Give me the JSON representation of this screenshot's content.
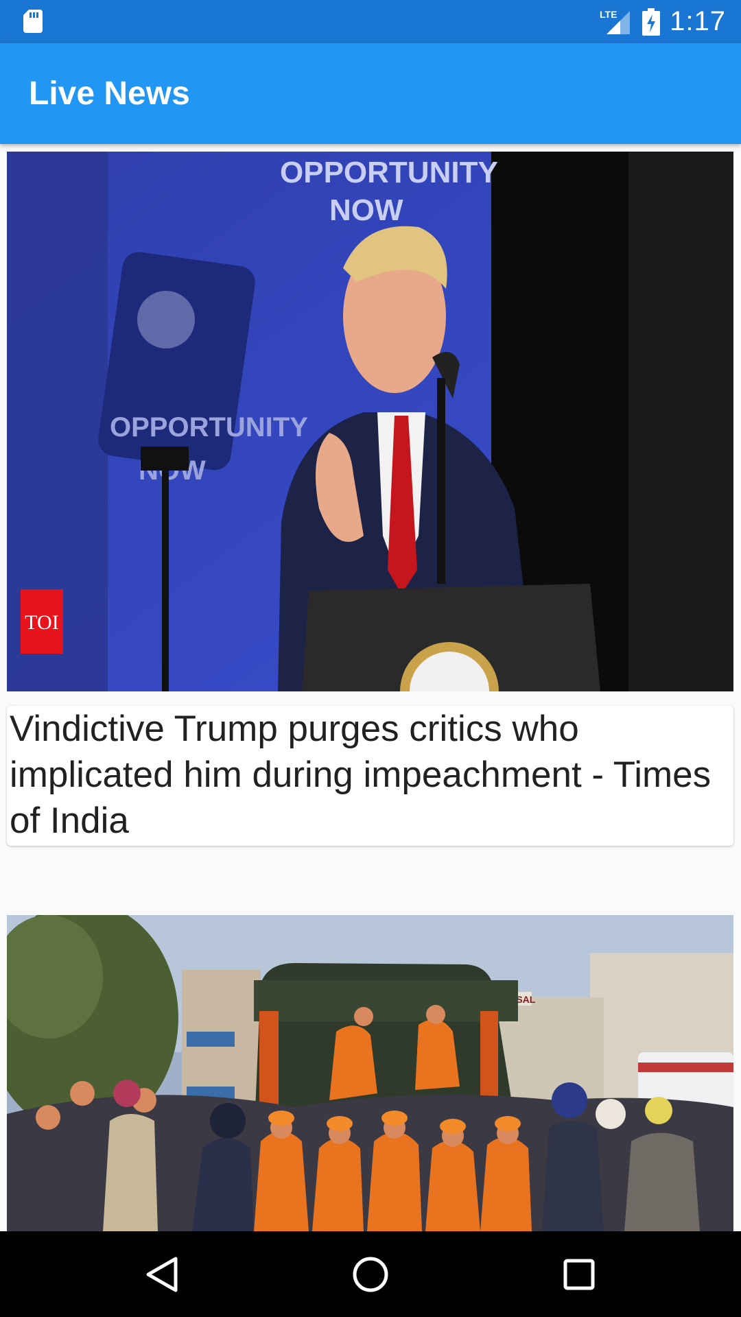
{
  "status_bar": {
    "time": "1:17",
    "network_label": "LTE",
    "icons": [
      "sd-card-icon",
      "signal-icon",
      "battery-charging-icon"
    ]
  },
  "app_bar": {
    "title": "Live News"
  },
  "feed": {
    "articles": [
      {
        "image_description": "news-photo",
        "image_badge": "TOI",
        "image_texts": [
          "OPPORTUNITY",
          "NOW",
          "OPPORTUNITY",
          "NOW"
        ],
        "title": "Vindictive Trump purges critics who implicated him during impeachment - Times of India"
      },
      {
        "image_description": "news-photo",
        "image_texts": [
          "BANSAL"
        ]
      }
    ]
  },
  "nav_bar": {
    "icons": [
      "back-icon",
      "home-icon",
      "recents-icon"
    ]
  },
  "colors": {
    "status_bar": "#1976d2",
    "app_bar": "#2196f3",
    "background": "#fafafa",
    "nav_bar": "#000000"
  }
}
